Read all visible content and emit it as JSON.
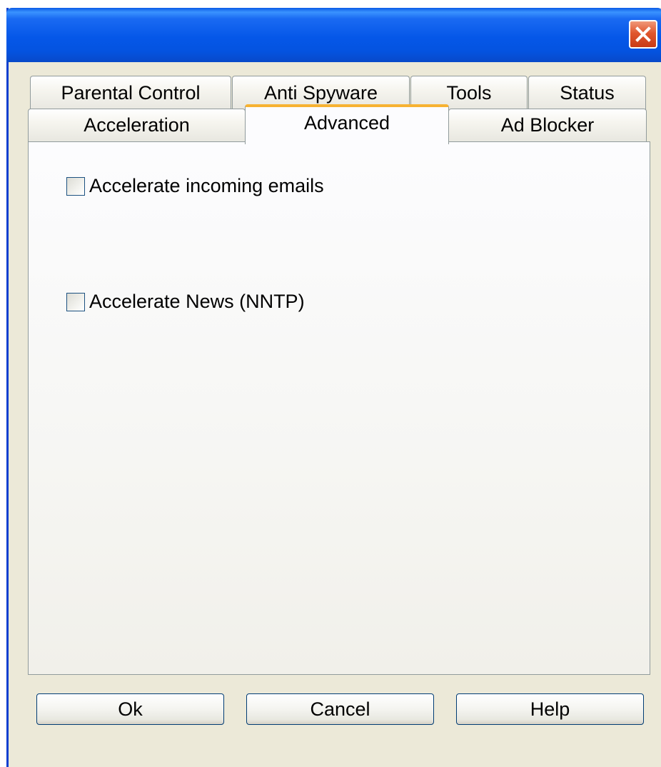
{
  "window": {
    "close_icon": "close-icon",
    "accent_color": "#0a5ae6"
  },
  "tabs": {
    "back_row": [
      "Parental Control",
      "Anti Spyware",
      "Tools",
      "Status"
    ],
    "front_row": [
      "Acceleration",
      "Advanced",
      "Ad Blocker"
    ],
    "selected": "Advanced"
  },
  "advanced_panel": {
    "options": [
      {
        "label": "Accelerate incoming emails",
        "checked": false
      },
      {
        "label": "Accelerate News (NNTP)",
        "checked": false
      }
    ]
  },
  "buttons": {
    "ok": "Ok",
    "cancel": "Cancel",
    "help": "Help"
  }
}
